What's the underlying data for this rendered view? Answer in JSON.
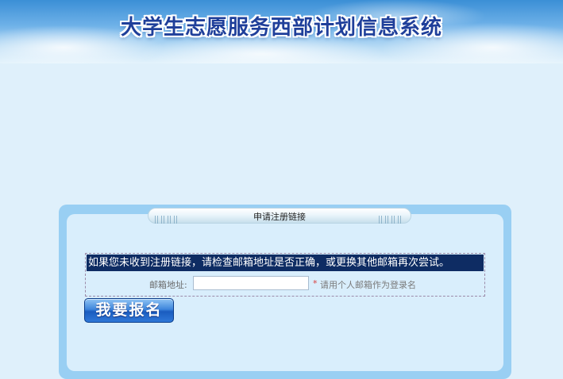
{
  "header": {
    "title": "大学生志愿服务西部计划信息系统"
  },
  "panel": {
    "title": "申请注册链接"
  },
  "form": {
    "notice": "如果您未收到注册链接，请检查邮箱地址是否正确，或更换其他邮箱再次尝试。",
    "email_label": "邮箱地址:",
    "email_value": "",
    "required_mark": "*",
    "email_hint": "请用个人邮箱作为登录名"
  },
  "signup_button": {
    "label": "我要报名"
  },
  "colors": {
    "background": "#dff0fb",
    "panel_border": "#99cff3",
    "panel_fill": "#d9eefc",
    "notice_bg": "#0e2c63",
    "button": "#2f78d8"
  }
}
